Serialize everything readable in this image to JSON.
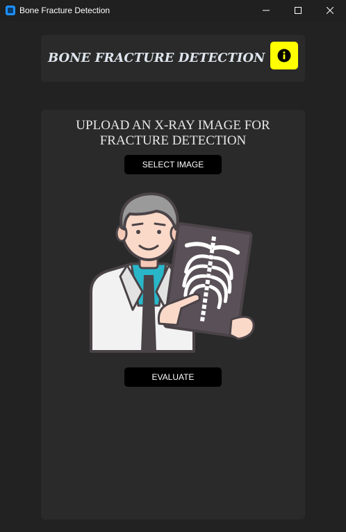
{
  "window": {
    "title": "Bone Fracture Detection",
    "controls": {
      "minimize": "minimize-icon",
      "maximize": "maximize-icon",
      "close": "close-icon"
    }
  },
  "header": {
    "title": "BONE FRACTURE DETECTION",
    "info_icon": "info-icon",
    "info_button_color": "#ffff00"
  },
  "main": {
    "heading_line1": "UPLOAD AN X-RAY IMAGE FOR",
    "heading_line2": "FRACTURE DETECTION",
    "select_button_label": "SELECT IMAGE",
    "evaluate_button_label": "EVALUATE",
    "illustration": "doctor-holding-xray-illustration"
  },
  "colors": {
    "background": "#222222",
    "card": "#2a2a2a",
    "button": "#000000",
    "info_button": "#ffff00"
  }
}
